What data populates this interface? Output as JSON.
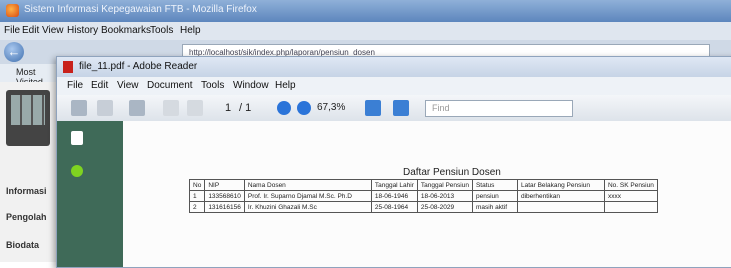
{
  "firefox": {
    "title": "Sistem Informasi Kepegawaian FTB - Mozilla Firefox",
    "menu": [
      "File",
      "Edit",
      "View",
      "History",
      "Bookmarks",
      "Tools",
      "Help"
    ],
    "url": "http://localhost/sik/index.php/laporan/pensiun_dosen",
    "bookmark": "Most Visited",
    "sidebar_items": [
      "Informasi",
      "Pengolah",
      "Biodata"
    ]
  },
  "reader": {
    "title": "file_11.pdf - Adobe Reader",
    "menu": [
      "File",
      "Edit",
      "View",
      "Document",
      "Tools",
      "Window",
      "Help"
    ],
    "page_current": "1",
    "page_total": "/ 1",
    "zoom": "67,3%",
    "find_placeholder": "Find"
  },
  "document": {
    "title": "Daftar Pensiun Dosen",
    "columns": [
      "No",
      "NIP",
      "Nama Dosen",
      "Tanggal Lahir",
      "Tanggal Pensiun",
      "Status",
      "Latar Belakang Pensiun",
      "No. SK Pensiun"
    ],
    "rows": [
      [
        "1",
        "133568610",
        "Prof. Ir. Suparno Djamal M.Sc. Ph.D",
        "18-06-1946",
        "18-06-2013",
        "pensiun",
        "diberhentikan",
        "xxxx"
      ],
      [
        "2",
        "131616156",
        "Ir. Khuzini Ghazali M.Sc",
        "25-08-1964",
        "25-08-2029",
        "masih aktif",
        "",
        ""
      ]
    ]
  }
}
